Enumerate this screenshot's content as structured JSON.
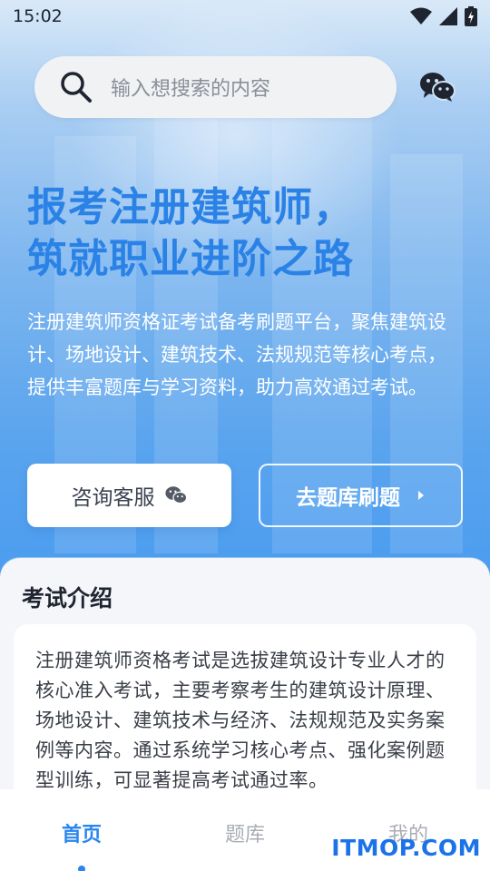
{
  "status_bar": {
    "time": "15:02",
    "icons": [
      "wifi-icon",
      "signal-icon",
      "battery-charging-icon"
    ]
  },
  "search": {
    "placeholder": "输入想搜索的内容",
    "icon": "search-icon"
  },
  "header": {
    "wechat_icon": "wechat-icon"
  },
  "hero": {
    "headline_line1": "报考注册建筑师，",
    "headline_line2": "筑就职业进阶之路",
    "description": "注册建筑师资格证考试备考刷题平台，聚焦建筑设计、场地设计、建筑技术、法规规范等核心考点，提供丰富题库与学习资料，助力高效通过考试。",
    "headline_color": "#2b82e6"
  },
  "actions": {
    "consult_label": "咨询客服",
    "consult_icon": "wechat-icon",
    "practice_label": "去题库刷题",
    "practice_icon": "chevron-right-icon"
  },
  "intro": {
    "title": "考试介绍",
    "text": "注册建筑师资格考试是选拔建筑设计专业人才的核心准入考试，主要考察考生的建筑设计原理、场地设计、建筑技术与经济、法规规范及实务案例等内容。通过系统学习核心考点、强化案例题型训练，可显著提高考试通过率。"
  },
  "tabs": [
    {
      "label": "首页",
      "active": true
    },
    {
      "label": "题库",
      "active": false
    },
    {
      "label": "我的",
      "active": false
    }
  ],
  "watermark": "ITMOP.COM",
  "colors": {
    "accent": "#2a86ee",
    "inactive_tab": "#a9adb4"
  }
}
